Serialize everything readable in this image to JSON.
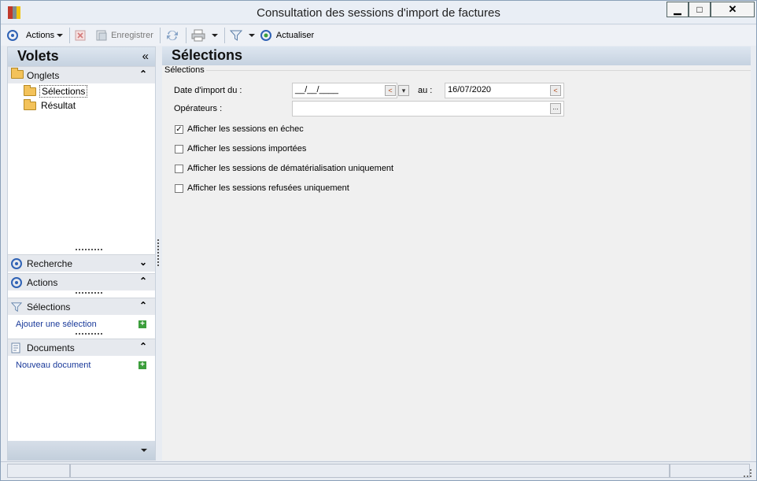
{
  "window": {
    "title": "Consultation des sessions d'import de factures",
    "minimize": "▁",
    "maximize": "□",
    "close": "✕"
  },
  "toolbar": {
    "actions_label": "Actions",
    "save_label": "Enregistrer",
    "refresh_label": "Actualiser"
  },
  "left_panel": {
    "title": "Volets",
    "collapse_glyph": "«",
    "onglets": {
      "label": "Onglets",
      "items": [
        {
          "label": "Sélections",
          "selected": true
        },
        {
          "label": "Résultat",
          "selected": false
        }
      ]
    },
    "sections": {
      "recherche": "Recherche",
      "actions": "Actions",
      "selections": "Sélections",
      "documents": "Documents"
    },
    "links": {
      "add_selection": "Ajouter une sélection",
      "new_document": "Nouveau document"
    }
  },
  "main": {
    "title": "Sélections",
    "group_label": "Sélections",
    "date_from_label": "Date d'import du :",
    "date_from_value": "__/__/____",
    "date_to_label": "au :",
    "date_to_value": "16/07/2020",
    "operators_label": "Opérateurs :",
    "operators_value": "",
    "operators_button": "...",
    "checkboxes": [
      {
        "label": "Afficher les sessions en échec",
        "checked": true
      },
      {
        "label": "Afficher les sessions importées",
        "checked": false
      },
      {
        "label": "Afficher les sessions de dématérialisation uniquement",
        "checked": false
      },
      {
        "label": "Afficher les sessions refusées uniquement",
        "checked": false
      }
    ]
  },
  "colors": {
    "accent": "#2f62b5",
    "link": "#1a3a9a",
    "folder": "#f3c25a",
    "add": "#3c9e3c"
  }
}
